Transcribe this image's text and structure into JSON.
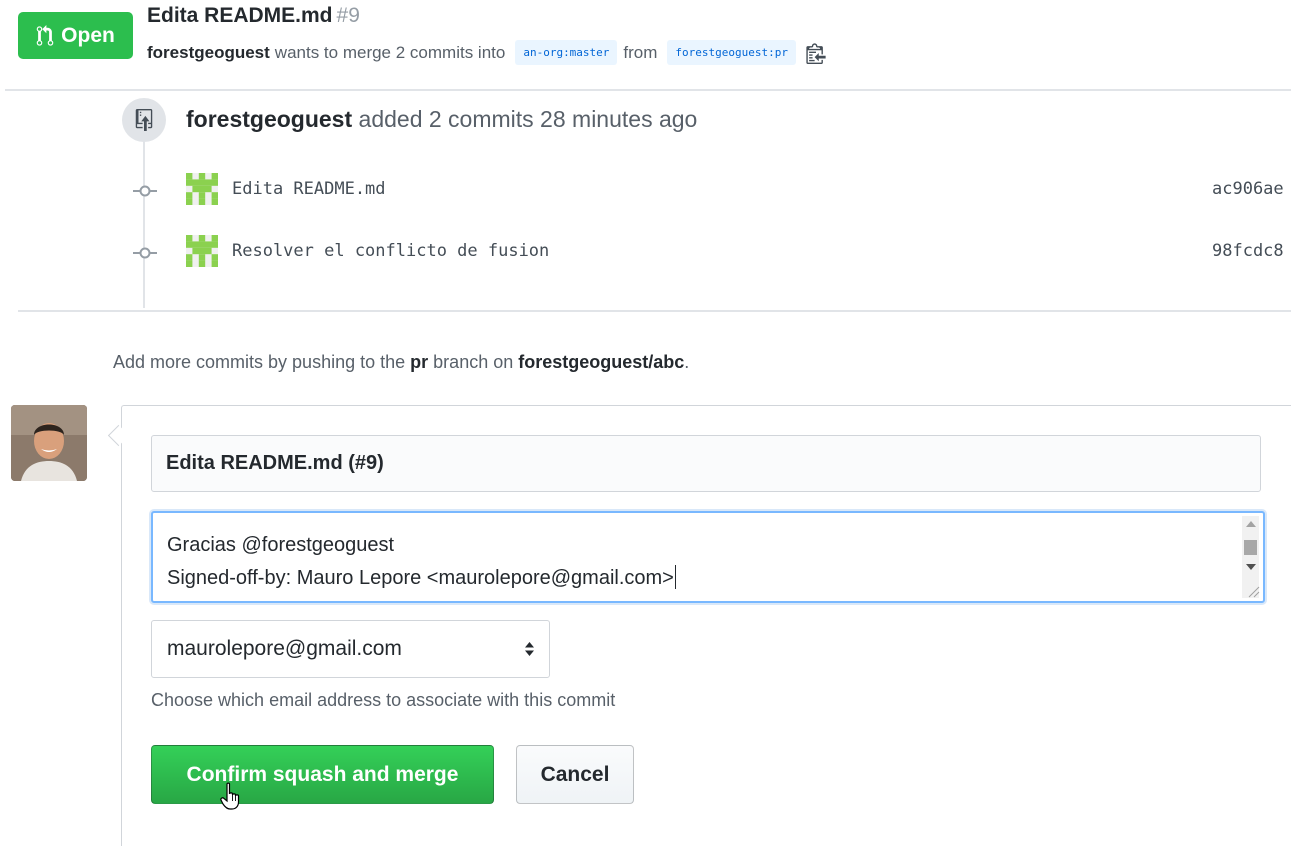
{
  "header": {
    "state_label": "Open",
    "state_color": "#2cbe4e",
    "title": "Edita README.md",
    "number": "#9",
    "author": "forestgeoguest",
    "wants_text": "wants to merge 2 commits into",
    "base_branch": "an-org:master",
    "from_text": "from",
    "head_branch": "forestgeoguest:pr",
    "state_icon": "git-pull-request-icon",
    "copy_icon": "clippy-icon"
  },
  "timeline": {
    "event_icon": "repo-push-icon",
    "actor": "forestgeoguest",
    "event_text": "added 2 commits 28 minutes ago",
    "commits": [
      {
        "message": "Edita README.md",
        "sha": "ac906ae",
        "icon": "git-commit-icon"
      },
      {
        "message": "Resolver el conflicto de fusion",
        "sha": "98fcdc8",
        "icon": "git-commit-icon"
      }
    ]
  },
  "hint": {
    "prefix": "Add more commits by pushing to the",
    "branch": "pr",
    "middle": "branch on",
    "repo": "forestgeoguest/abc",
    "suffix": "."
  },
  "merge_form": {
    "commit_title": "Edita README.md (#9)",
    "body_line_1": "Gracias @forestgeoguest",
    "body_line_2": "Signed-off-by: Mauro Lepore <maurolepore@gmail.com>",
    "email_selected": "maurolepore@gmail.com",
    "email_hint": "Choose which email address to associate with this commit",
    "confirm_label": "Confirm squash and merge",
    "cancel_label": "Cancel",
    "confirm_color": "#28a745"
  }
}
